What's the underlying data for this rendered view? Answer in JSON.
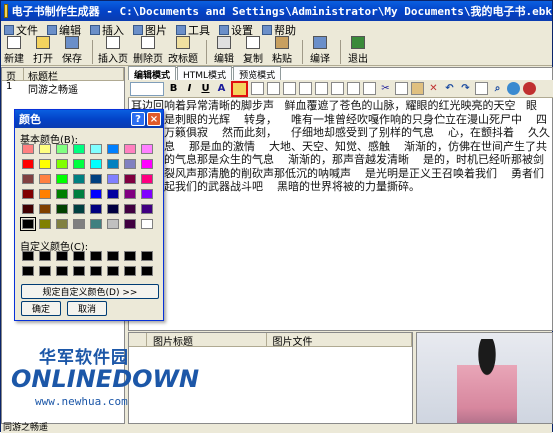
{
  "window": {
    "title": "电子书制作生成器 - C:\\Documents and Settings\\Administrator\\My Documents\\我的电子书.ebk"
  },
  "menu": [
    "文件",
    "编辑",
    "插入",
    "图片",
    "工具",
    "设置",
    "帮助"
  ],
  "toolbar": [
    "新建",
    "打开",
    "保存",
    "插入页",
    "删除页",
    "改标题",
    "编辑",
    "复制",
    "粘贴",
    "编译",
    "退出"
  ],
  "left_panel": {
    "columns": [
      "页",
      "标题栏"
    ],
    "rows": [
      {
        "page": "1",
        "title": "同游之畅遥"
      }
    ]
  },
  "editor": {
    "tabs": [
      "编辑模式",
      "HTML模式",
      "预览模式"
    ],
    "format_buttons": [
      "B",
      "I",
      "U",
      "A"
    ],
    "content": "耳边回响着异常清晰的脚步声   鲜血覆遮了苍色的山脉，耀眼的红光映亮的天空   眼前，满是刺眼的光辉    转身，    唯有一堆曾经吹嘎作响的只身伫立在漫山死尸中    四下里，万籁俱寂    然而此刻，    仔细地却感受到了别样的气息    心，在颤抖着    久久不能平息    那是血的激情    大地、天空、知觉、感触    渐渐的，仿佛在世间产生了共鸣万物的气息那是众生的气息    渐渐的，那声音越发清晰    是的，时机已经听那被剑划开的裂风声那清脆的削砍声那低沉的呐喊声    是光明是正义王召唤着我们    勇者们啊再次起我们的武器战斗吧    黑暗的世界将被的力量撕碎。"
  },
  "bottom_table": {
    "columns": [
      "图片标题",
      "图片文件"
    ]
  },
  "watermark": {
    "cn": "华军软件园",
    "en": "ONLINEDOWN",
    "url": "www.newhua.com"
  },
  "status": {
    "text": "同游之畅遥"
  },
  "color_dialog": {
    "title": "颜色",
    "help_label": "?",
    "close_label": "×",
    "basic_label": "基本颜色(B):",
    "custom_label": "自定义颜色(C):",
    "define_button": "规定自定义颜色(D) >>",
    "ok_button": "确定",
    "cancel_button": "取消",
    "basic_colors": [
      "#ff8080",
      "#ffff80",
      "#80ff80",
      "#00ff80",
      "#80ffff",
      "#0080ff",
      "#ff80c0",
      "#ff80ff",
      "#ff0000",
      "#ffff00",
      "#80ff00",
      "#00ff40",
      "#00ffff",
      "#0080c0",
      "#8080c0",
      "#ff00ff",
      "#804040",
      "#ff8040",
      "#00ff00",
      "#008080",
      "#004080",
      "#8080ff",
      "#800040",
      "#ff0080",
      "#800000",
      "#ff8000",
      "#008000",
      "#008040",
      "#0000ff",
      "#0000a0",
      "#800080",
      "#8000ff",
      "#400000",
      "#804000",
      "#004000",
      "#004040",
      "#000080",
      "#000040",
      "#400040",
      "#400080",
      "#000000",
      "#808000",
      "#808040",
      "#808080",
      "#408080",
      "#c0c0c0",
      "#400040",
      "#ffffff"
    ],
    "selected_index": 40
  }
}
